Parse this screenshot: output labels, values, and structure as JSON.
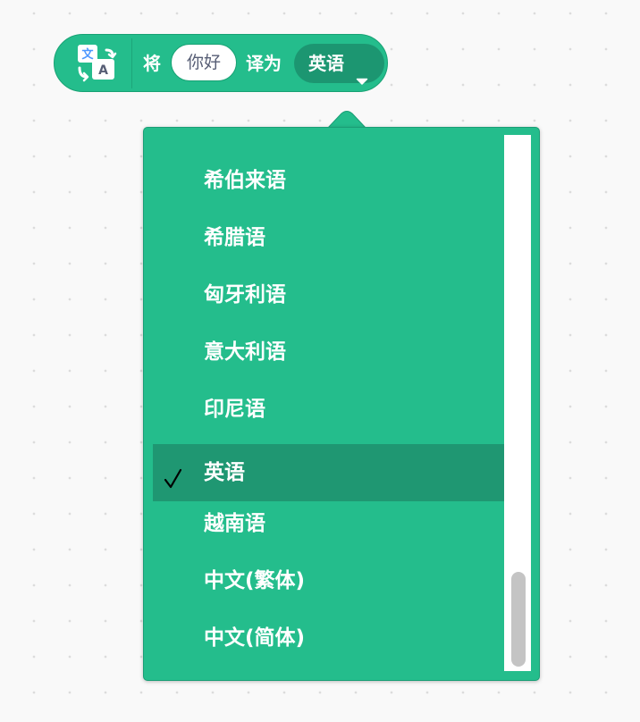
{
  "block": {
    "icon": "translate-icon",
    "text_before": "将",
    "input_value": "你好",
    "text_middle": "译为",
    "language_selected": "英语",
    "caret_icon": "caret-down-icon"
  },
  "menu": {
    "items": [
      {
        "label": "希伯来语",
        "selected": false
      },
      {
        "label": "希腊语",
        "selected": false
      },
      {
        "label": "匈牙利语",
        "selected": false
      },
      {
        "label": "意大利语",
        "selected": false
      },
      {
        "label": "印尼语",
        "selected": false
      },
      {
        "label": "英语",
        "selected": true
      },
      {
        "label": "越南语",
        "selected": false
      },
      {
        "label": "中文(繁体)",
        "selected": false
      },
      {
        "label": "中文(简体)",
        "selected": false
      }
    ],
    "check_icon": "checkmark-icon"
  },
  "colors": {
    "block_green": "#24bd8c",
    "selected_row": "#1f9772",
    "dropdown_dark": "#1c9671",
    "input_text": "#575e75"
  }
}
